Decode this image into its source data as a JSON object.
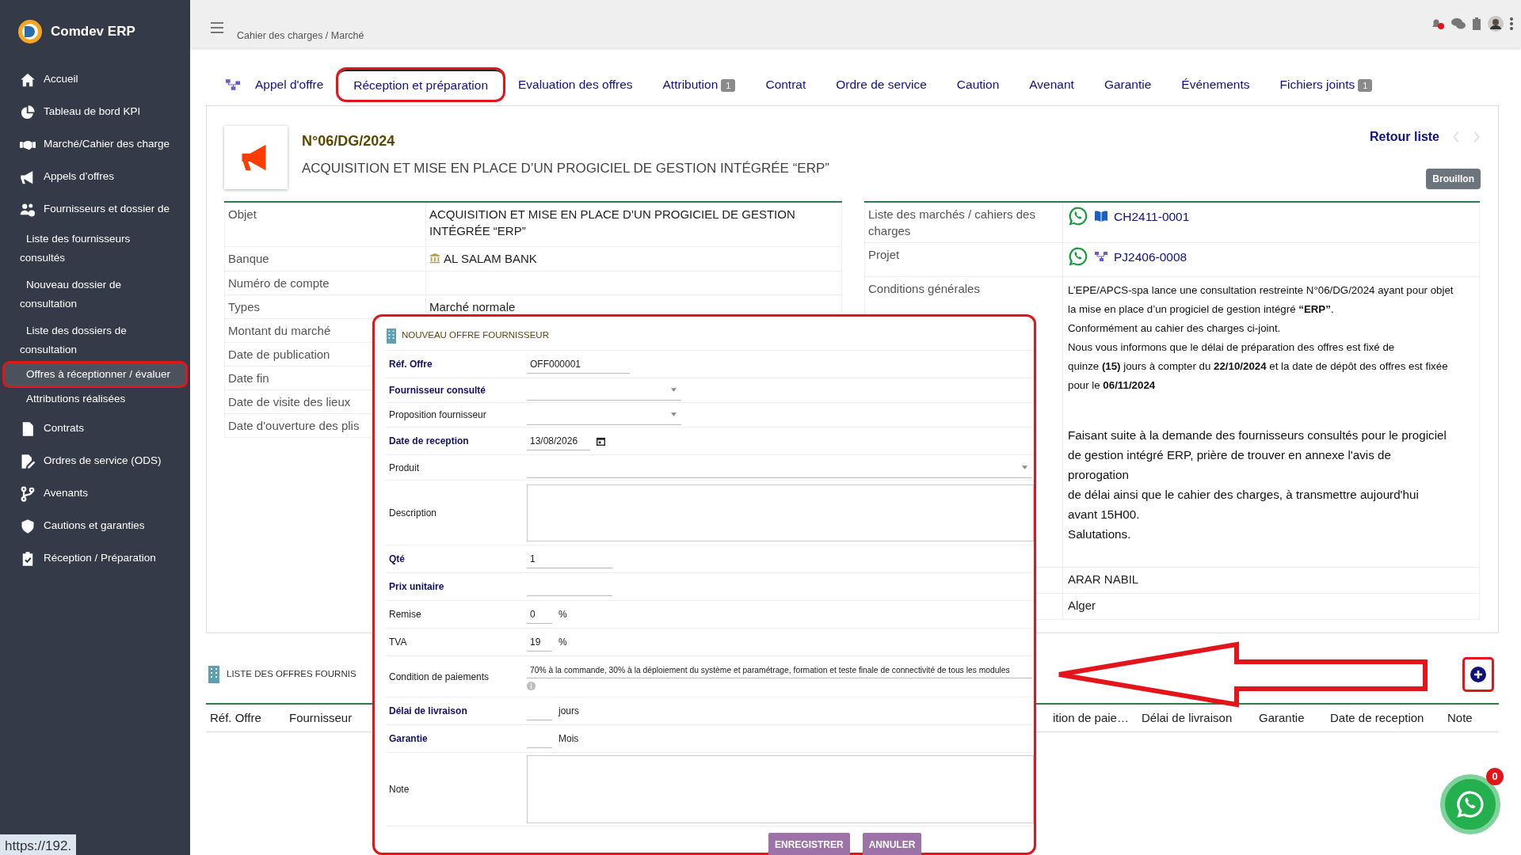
{
  "app": {
    "name": "Comdev ERP"
  },
  "sidebar": {
    "items": [
      {
        "label": "Accueil",
        "selected": false
      },
      {
        "label": "Tableau de bord KPI",
        "selected": false
      },
      {
        "label": "Marché/Cahier des charge",
        "selected": false
      },
      {
        "label": "Appels d’offres",
        "selected": false
      },
      {
        "label": "Fournisseurs et dossier de",
        "selected": false,
        "expanded": true,
        "children": [
          {
            "label": "Liste des fournisseurs consultés",
            "selected": false
          },
          {
            "label": "Nouveau dossier de consultation",
            "selected": false
          },
          {
            "label": "Liste des dossiers de consultation",
            "selected": false
          },
          {
            "label": "Offres à réceptionner / évaluer",
            "selected": true
          },
          {
            "label": "Attributions réalisées",
            "selected": false
          }
        ]
      },
      {
        "label": "Contrats",
        "selected": false
      },
      {
        "label": "Ordres de service (ODS)",
        "selected": false
      },
      {
        "label": "Avenants",
        "selected": false
      },
      {
        "label": "Cautions et garanties",
        "selected": false
      },
      {
        "label": "Réception / Préparation",
        "selected": false
      }
    ]
  },
  "topbar": {
    "breadcrumb": "Cahier des charges / Marché"
  },
  "tabs": [
    {
      "label": "Appel d'offre",
      "selected": false
    },
    {
      "label": "Réception et préparation",
      "selected": true
    },
    {
      "label": "Evaluation des offres",
      "selected": false
    },
    {
      "label": "Attribution",
      "badge": "1",
      "selected": false
    },
    {
      "label": "Contrat",
      "selected": false
    },
    {
      "label": "Ordre de service",
      "selected": false
    },
    {
      "label": "Caution",
      "selected": false
    },
    {
      "label": "Avenant",
      "selected": false
    },
    {
      "label": "Garantie",
      "selected": false
    },
    {
      "label": "Événements",
      "selected": false
    },
    {
      "label": "Fichiers joints",
      "badge": "1",
      "selected": false
    }
  ],
  "record": {
    "reference": "N°06/DG/2024",
    "title": "ACQUISITION ET MISE EN PLACE D’UN PROGICIEL DE GESTION INTÉGRÉE “ERP”",
    "back_link": "Retour liste",
    "status": "Brouillon"
  },
  "details_left": [
    {
      "label": "Objet",
      "value": "ACQUISITION ET MISE EN PLACE D’UN PROGICIEL DE GESTION INTÉGRÉE “ERP”"
    },
    {
      "label": "Banque",
      "value": "AL SALAM BANK",
      "kind": "bank"
    },
    {
      "label": "Numéro de compte"
    },
    {
      "label": "Types",
      "value": "Marché normale"
    },
    {
      "label": "Montant du marché"
    },
    {
      "label": "Date de publication"
    },
    {
      "label": "Date fin"
    },
    {
      "label": "Date de visite des lieux"
    },
    {
      "label": "Date d'ouverture des plis"
    }
  ],
  "details_right": [
    {
      "label": "Liste des marchés / cahiers des charges",
      "value": "CH2411-0001",
      "kind": "market"
    },
    {
      "label": "Projet",
      "value": "PJ2406-0008",
      "kind": "project"
    },
    {
      "label": "Conditions générales",
      "kind": "conditions",
      "lines": [
        "L’EPE/APCS-spa lance une consultation restreinte N°06/DG/2024 ayant pour objet",
        "la mise en place d’un progiciel de gestion intégré **“ERP”**.",
        "Conformément au cahier des charges ci-joint.",
        "Nous vous informons que le délai de préparation des offres est fixé de",
        "quinze **(15)** jours à compter du **22/10/2024** et la date de dépôt des offres est fixée",
        "pour le **06/11/2024**"
      ],
      "message": [
        "Faisant suite à la demande des fournisseurs consultés pour le progiciel",
        "de gestion intégré ERP, prière de trouver en annexe l'avis de",
        "prorogation",
        "de délai ainsi que le cahier des charges, à transmettre aujourd'hui",
        "avant 15H00.",
        "Salutations."
      ]
    },
    {
      "value": "ARAR NABIL"
    },
    {
      "value": "Alger"
    }
  ],
  "dialog": {
    "title": "NOUVEAU OFFRE FOURNISSEUR",
    "fields": [
      {
        "label": "Réf. Offre",
        "required": true,
        "kind": "text",
        "value": "OFF000001"
      },
      {
        "label": "Fournisseur consulté",
        "required": true,
        "kind": "select",
        "wide": false
      },
      {
        "label": "Proposition fournisseur",
        "required": false,
        "kind": "select",
        "wide": false
      },
      {
        "label": "Date de reception",
        "required": true,
        "kind": "date",
        "value": "13/08/2026"
      },
      {
        "label": "Produit",
        "required": false,
        "kind": "select",
        "wide": true
      },
      {
        "label": "Description",
        "required": false,
        "kind": "textarea"
      },
      {
        "label": "Qté",
        "required": true,
        "kind": "text",
        "value": "1"
      },
      {
        "label": "Prix unitaire",
        "required": true,
        "kind": "text"
      },
      {
        "label": "Remise",
        "required": false,
        "kind": "unit",
        "value": "0",
        "unit": "%"
      },
      {
        "label": "TVA",
        "required": false,
        "kind": "unit",
        "value": "19",
        "unit": "%"
      },
      {
        "label": "Condition de paiements",
        "required": false,
        "kind": "longtext",
        "value": "70% à la commande, 30% à la déploiement du système et paramétrage, formation et teste finale de connectivité de tous les modules"
      },
      {
        "label": "Délai de livraison",
        "required": true,
        "kind": "unit",
        "unit": "jours"
      },
      {
        "label": "Garantie",
        "required": true,
        "kind": "unit",
        "unit": "Mois"
      },
      {
        "label": "Note",
        "required": false,
        "kind": "notes"
      }
    ],
    "buttons": [
      "ENREGISTRER",
      "ANNULER"
    ]
  },
  "offers_list": {
    "title": "LISTE DES OFFRES FOURNIS",
    "columns": [
      "Réf. Offre",
      "Fournisseur",
      "ition de paie…",
      "Délai de livraison",
      "Garantie",
      "Date de reception",
      "Note"
    ]
  },
  "chat": {
    "badge": "0"
  },
  "status_url": "https://192."
}
